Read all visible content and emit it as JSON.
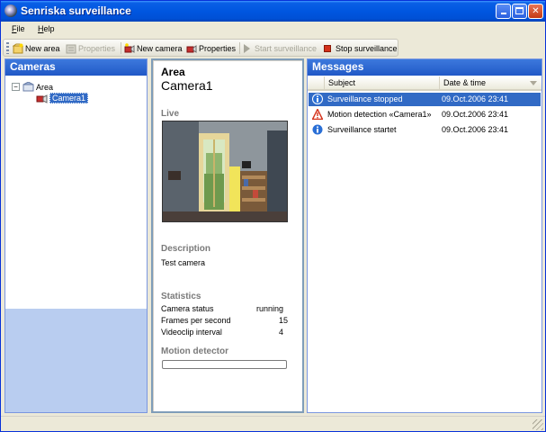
{
  "window": {
    "title": "Senriska surveillance"
  },
  "menu": {
    "file": {
      "underlined": "F",
      "rest": "ile"
    },
    "help": {
      "underlined": "H",
      "rest": "elp"
    }
  },
  "toolbar": {
    "new_area": "New area",
    "area_properties": "Properties",
    "new_camera": "New camera",
    "camera_properties": "Properties",
    "start_surveillance": "Start surveillance",
    "stop_surveillance": "Stop surveillance"
  },
  "cameras_panel": {
    "title": "Cameras",
    "tree": {
      "area": "Area",
      "camera": "Camera1"
    }
  },
  "detail": {
    "area": "Area",
    "camera": "Camera1",
    "live_label": "Live",
    "description_label": "Description",
    "description": "Test camera",
    "statistics_label": "Statistics",
    "stats": [
      {
        "label": "Camera status",
        "value": "running"
      },
      {
        "label": "Frames per second",
        "value": "15"
      },
      {
        "label": "Videoclip interval",
        "value": "4"
      }
    ],
    "motion_label": "Motion detector",
    "motion_level": 0
  },
  "messages_panel": {
    "title": "Messages",
    "columns": {
      "subject": "Subject",
      "datetime": "Date & time"
    },
    "rows": [
      {
        "icon": "info-icon",
        "subject": "Surveillance stopped",
        "datetime": "09.Oct.2006 23:41",
        "selected": true
      },
      {
        "icon": "warning-icon",
        "subject": "Motion detection «Camera1»",
        "datetime": "09.Oct.2006 23:41",
        "selected": false
      },
      {
        "icon": "info-icon",
        "subject": "Surveillance startet",
        "datetime": "09.Oct.2006 23:41",
        "selected": false
      }
    ]
  },
  "colors": {
    "titlebar": "#0055e5",
    "panel_header": "#2a63cf",
    "selection": "#316ac5",
    "tree_lower": "#b9cdf0"
  }
}
